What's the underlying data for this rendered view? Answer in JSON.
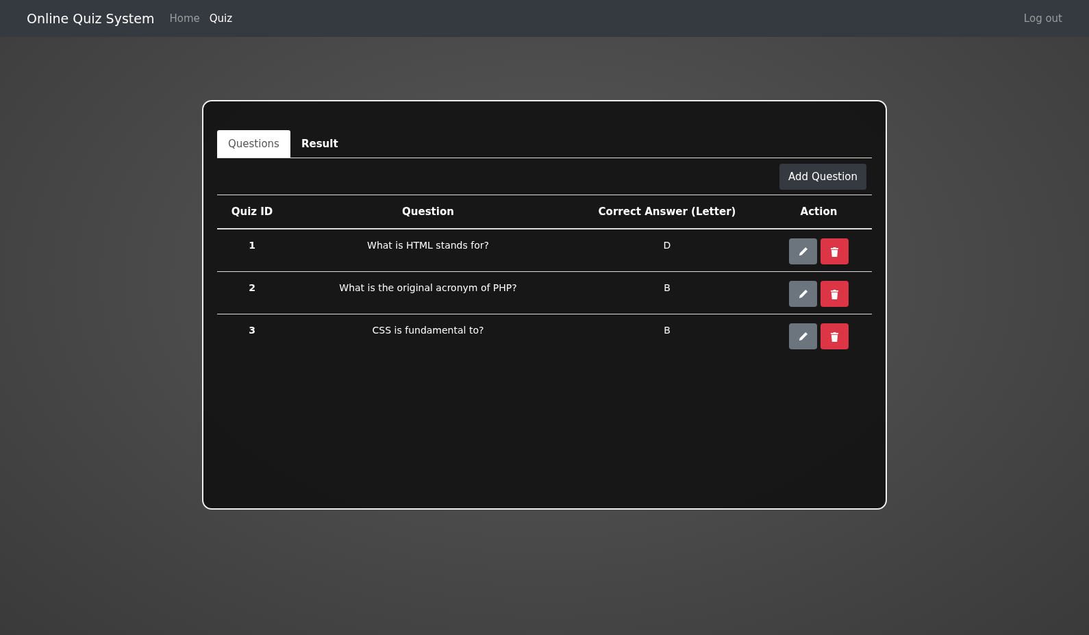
{
  "navbar": {
    "brand": "Online Quiz System",
    "links": [
      {
        "label": "Home",
        "selected": false
      },
      {
        "label": "Quiz",
        "selected": true
      }
    ],
    "logout": "Log out"
  },
  "tabs": [
    {
      "label": "Questions",
      "selected": true
    },
    {
      "label": "Result",
      "selected": false
    }
  ],
  "add_button": "Add Question",
  "table": {
    "columns": [
      "Quiz ID",
      "Question",
      "Correct Answer (Letter)",
      "Action"
    ],
    "rows": [
      {
        "id": "1",
        "question": "What is HTML stands for?",
        "answer": "D"
      },
      {
        "id": "2",
        "question": "What is the original acronym of PHP?",
        "answer": "B"
      },
      {
        "id": "3",
        "question": "CSS is fundamental to?",
        "answer": "B"
      }
    ]
  }
}
